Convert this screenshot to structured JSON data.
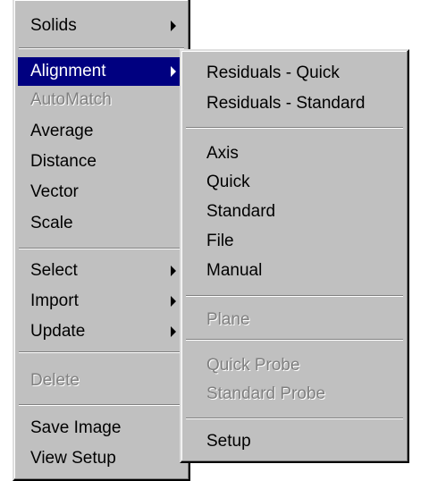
{
  "main_menu": {
    "solids": "Solids",
    "alignment": "Alignment",
    "automatch": "AutoMatch",
    "average": "Average",
    "distance": "Distance",
    "vector": "Vector",
    "scale": "Scale",
    "select": "Select",
    "import": "Import",
    "update": "Update",
    "delete": "Delete",
    "save_image": "Save Image",
    "view_setup": "View Setup"
  },
  "sub_menu": {
    "residuals_quick": "Residuals - Quick",
    "residuals_standard": "Residuals - Standard",
    "axis": "Axis",
    "quick": "Quick",
    "standard": "Standard",
    "file": "File",
    "manual": "Manual",
    "plane": "Plane",
    "quick_probe": "Quick Probe",
    "standard_probe": "Standard Probe",
    "setup": "Setup"
  },
  "colors": {
    "menu_bg": "#c0c0c0",
    "highlight": "#000080",
    "disabled_text": "#808080"
  }
}
